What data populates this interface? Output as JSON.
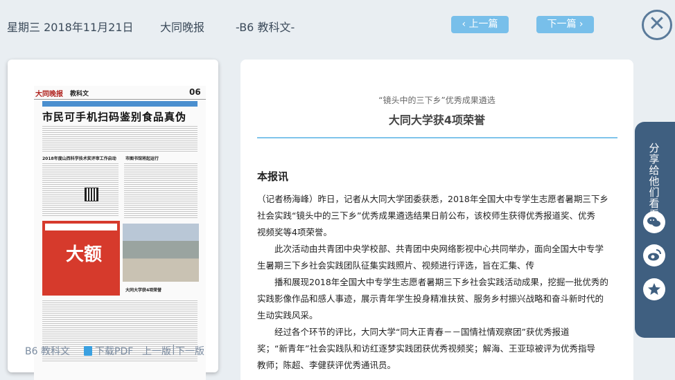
{
  "header": {
    "date": "星期三 2018年11月21日",
    "paper_name": "大同晚报",
    "section": "-B6 教科文-",
    "prev_label": "上一篇",
    "next_label": "下一篇",
    "close_glyph": "✕"
  },
  "thumbnail": {
    "logo_text": "大同晚报",
    "section_text": "教科文",
    "page_number": "06",
    "headline": "市民可手机扫码鉴别食品真伪",
    "sub_a": "2018年度山西科学技术奖评审工作启动",
    "sub_b": "市图书馆将起运行",
    "sub_c": "大同大学获4项荣誉",
    "ad_text": "大额",
    "footer_section": "B6 教科文",
    "footer_pdf": "下载PDF",
    "footer_prev": "上一版",
    "footer_sep": "|",
    "footer_next": "下一版"
  },
  "article": {
    "kicker": "“镜头中的三下乡”优秀成果遴选",
    "title": "大同大学获4项荣誉",
    "source": "本报讯",
    "p1_lines": [
      "（记者杨海峰）昨日，记者从大同大学团委获悉，2018年全国大中专学生志愿者暑期三下乡",
      "社会实践“镜头中的三下乡”优秀成果遴选结果日前公布，该校师生获得优秀报道奖、优秀",
      "视频奖等4项荣誉。"
    ],
    "p2_lines": [
      "　　此次活动由共青团中央学校部、共青团中央网络影视中心共同举办，面向全国大中专学",
      "生暑期三下乡社会实践团队征集实践照片、视频进行评选，旨在汇集、传",
      "　　播和展现2018年全国大中专学生志愿者暑期三下乡社会实践活动成果，挖掘一批优秀的",
      "实践影像作品和感人事迹，展示青年学生投身精准扶贫、服务乡村振兴战略和奋斗新时代的",
      "生动实践风采。"
    ],
    "p3_lines": [
      "　　经过各个环节的评比，大同大学“同大正青春－－国情社情观察团”获优秀报道",
      "奖；“新青年”社会实践队和访红逐梦实践团获优秀视频奖；解海、王亚琼被评为优秀指导",
      "教师；陈超、李健获评优秀通讯员。"
    ]
  },
  "share": {
    "label": "分享给他们看看",
    "icons": [
      "wechat-icon",
      "weibo-icon",
      "favorite-star-icon"
    ]
  }
}
